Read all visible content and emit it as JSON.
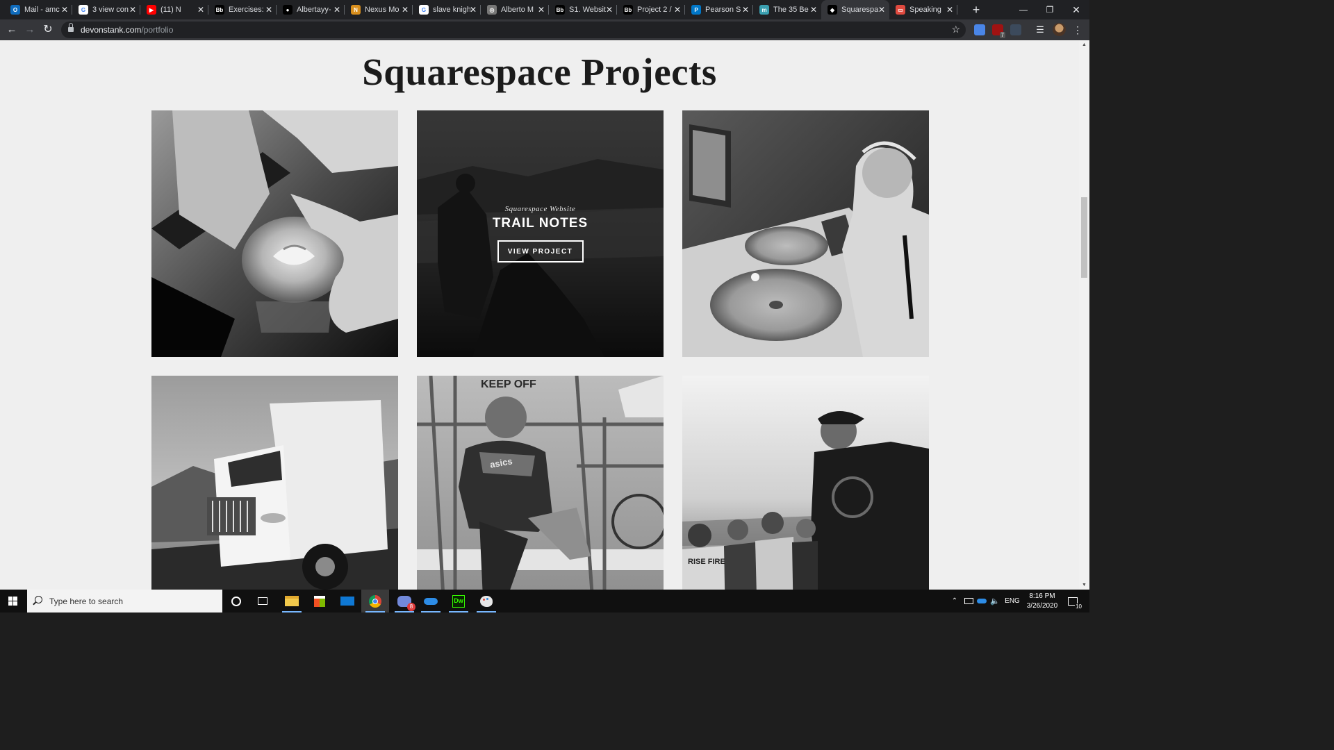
{
  "browser": {
    "tabs": [
      {
        "title": "Mail - amc",
        "favicon": "outlook-icon",
        "color": "#0f6cbd",
        "glyph": "O"
      },
      {
        "title": "3 view con",
        "favicon": "google-icon",
        "color": "#ffffff",
        "glyph": "G"
      },
      {
        "title": "(11) N",
        "favicon": "youtube-icon",
        "color": "#ff0000",
        "glyph": "▶"
      },
      {
        "title": "Exercises: ",
        "favicon": "blackboard-icon",
        "color": "#000000",
        "glyph": "Bb"
      },
      {
        "title": "Albertayy-",
        "favicon": "github-icon",
        "color": "#000000",
        "glyph": "●"
      },
      {
        "title": "Nexus Mo",
        "favicon": "nexus-icon",
        "color": "#d98f1d",
        "glyph": "N"
      },
      {
        "title": "slave knigh",
        "favicon": "google-icon",
        "color": "#ffffff",
        "glyph": "G"
      },
      {
        "title": "Alberto M",
        "favicon": "globe-icon",
        "color": "#777777",
        "glyph": "◎"
      },
      {
        "title": "S1. Websit",
        "favicon": "blackboard-icon",
        "color": "#000000",
        "glyph": "Bb"
      },
      {
        "title": "Project 2 /",
        "favicon": "blackboard-icon",
        "color": "#000000",
        "glyph": "Bb"
      },
      {
        "title": "Pearson S",
        "favicon": "pearson-icon",
        "color": "#0077c8",
        "glyph": "P"
      },
      {
        "title": "The 35 Be",
        "favicon": "medium-icon",
        "color": "#3a9fb0",
        "glyph": "m"
      },
      {
        "title": "Squarespa",
        "favicon": "squarespace-icon",
        "color": "#000000",
        "glyph": "◆"
      },
      {
        "title": "Speaking",
        "favicon": "slides-icon",
        "color": "#e04a3f",
        "glyph": "▭"
      }
    ],
    "active_tab_index": 12,
    "address": {
      "domain": "devonstank.com",
      "path": "/portfolio"
    },
    "extension_badge": "7"
  },
  "page": {
    "heading": "Squarespace Projects",
    "featured": {
      "kicker": "Squarespace Website",
      "title": "TRAIL NOTES",
      "button": "VIEW PROJECT"
    },
    "sign_text": "KEEP OFF",
    "jersey_brand": "asics",
    "shirt_text": "RISE FIRE"
  },
  "taskbar": {
    "search_placeholder": "Type here to search",
    "language": "ENG",
    "time": "8:16 PM",
    "date": "3/26/2020",
    "notification_count": "10",
    "discord_badge": "8"
  },
  "colors": {
    "page_bg": "#efefef",
    "chrome_bg": "#202124",
    "toolbar_bg": "#35363a",
    "taskbar_bg": "#101010"
  }
}
